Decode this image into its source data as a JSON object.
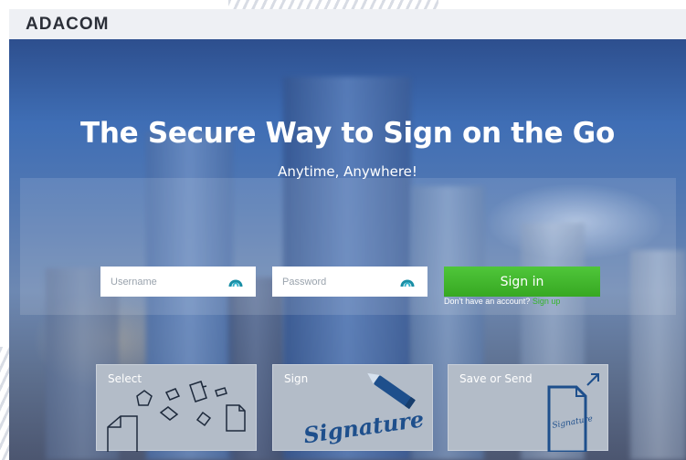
{
  "header": {
    "logo": "ADACOM"
  },
  "hero": {
    "title": "The Secure Way to Sign on the Go",
    "subtitle": "Anytime, Anywhere!"
  },
  "login": {
    "username_placeholder": "Username",
    "password_placeholder": "Password",
    "signin_label": "Sign in",
    "no_account_text": "Don't have an account?",
    "signup_link": "Sign up"
  },
  "features": [
    {
      "label": "Select",
      "icon": "documents-icon"
    },
    {
      "label": "Sign",
      "icon": "signature-pen-icon",
      "art_text": "Signature"
    },
    {
      "label": "Save or Send",
      "icon": "send-document-icon",
      "art_text": "Signature"
    }
  ],
  "colors": {
    "accent_green": "#37a822",
    "link_green": "#35b52a",
    "fingerprint_teal": "#1a8fa6"
  }
}
